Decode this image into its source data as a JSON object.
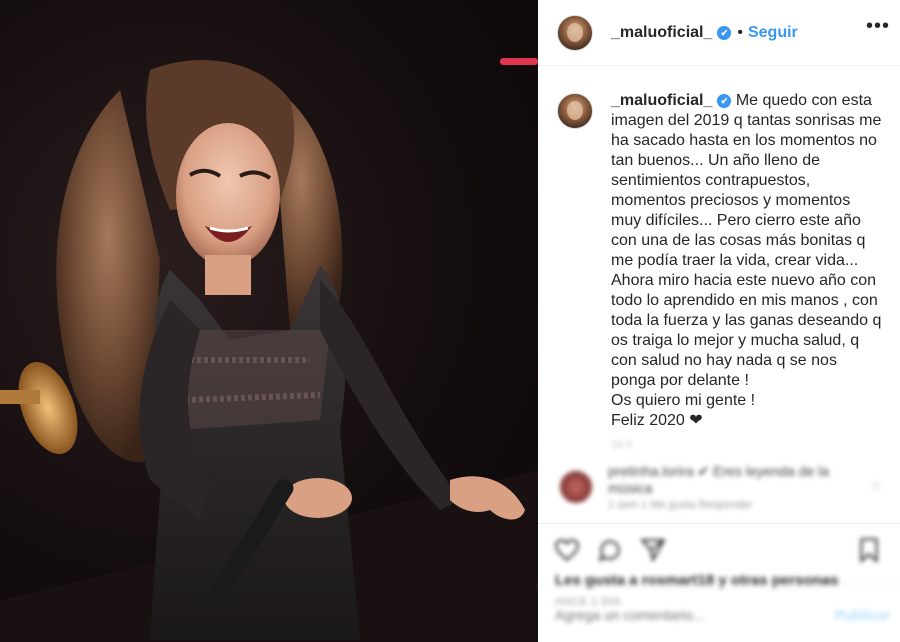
{
  "post": {
    "username": "_maluoficial_",
    "verified_mark": "✔",
    "follow_label": "Seguir",
    "more_label": "•••",
    "dot": "•",
    "caption": "Me quedo con esta imagen del 2019 q tantas sonrisas me ha sacado hasta en los momentos no tan buenos... Un año lleno de sentimientos contrapuestos, momentos preciosos y momentos muy difíciles... Pero cierro este año con una de las cosas más bonitas q me podía traer la vida, crear vida... Ahora miro hacia este nuevo año con todo lo aprendido en mis manos , con toda la fuerza y las ganas deseando q os traiga lo mejor y mucha salud, q con salud no hay nada q se nos ponga por delante !\nOs quiero mi gente !\nFeliz 2020 ❤",
    "caption_time": "16 h",
    "comment": {
      "text": "pretinha.lorira ✔ Eres leyenda de la música",
      "sub": "1 sem  1 Me gusta  Responder"
    },
    "likes_text": "Les gusta a rosmart18 y otras personas",
    "date": "HACE 1 DÍA",
    "comment_placeholder": "Agrega un comentario...",
    "post_label": "Publicar"
  },
  "colors": {
    "accent": "#3897f0",
    "text": "#262626",
    "muted": "#999999"
  },
  "icons": [
    "heart-icon",
    "comment-icon",
    "share-icon",
    "bookmark-icon",
    "more-icon",
    "verified-icon"
  ]
}
